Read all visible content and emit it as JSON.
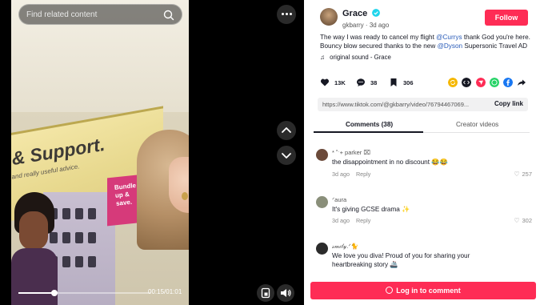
{
  "video": {
    "search_placeholder": "Find related content",
    "time": "00:15/01:01",
    "progress": 0.27,
    "sign_title": "& Support.",
    "sign_subtitle": "and really useful advice.",
    "shelf_label": "Bundle up & save."
  },
  "author": {
    "name": "Grace",
    "handle": "gkbarry",
    "date": "3d ago",
    "follow_label": "Follow"
  },
  "description": {
    "part1": "The way I was ready to cancel my flight ",
    "mention1": "@Currys",
    "part2": " thank God you're here. Bouncy blow secured thanks to the new ",
    "mention2": "@Dyson",
    "part3": " Supersonic Travel AD"
  },
  "sound": "original sound - Grace",
  "actions": {
    "likes": "13K",
    "comments": "38",
    "saves": "306"
  },
  "share_colors": [
    "#f5b700",
    "#161823",
    "#fe2c55",
    "#25d366",
    "#1877f2"
  ],
  "link": {
    "url": "https://www.tiktok.com/@gkbarry/video/76794467069...",
    "copy_label": "Copy link"
  },
  "tabs": {
    "comments": "Comments (38)",
    "creator": "Creator videos"
  },
  "comments": [
    {
      "user": "* ˚ˑ+ parker ⌧",
      "text": "the disappointment in no discount 😂😂",
      "date": "3d ago",
      "reply": "Reply",
      "likes": "257",
      "avatar_color": "#6b4a3a"
    },
    {
      "user": "ᐟaura",
      "text": "It's giving GCSE drama ✨",
      "date": "3d ago",
      "reply": "Reply",
      "likes": "302",
      "avatar_color": "#8a8f7a"
    },
    {
      "user": "𝓈𝓂𝒾𝓁𝓎.ᐟ🐈",
      "text": "We love you diva! Proud of you for sharing your heartbreaking story 🚢",
      "date": "",
      "reply": "",
      "likes": "",
      "avatar_color": "#2b2b2b"
    }
  ],
  "login_label": "Log in to comment",
  "colors": {
    "brand": "#fe2c55",
    "mention": "#2b5db9"
  }
}
